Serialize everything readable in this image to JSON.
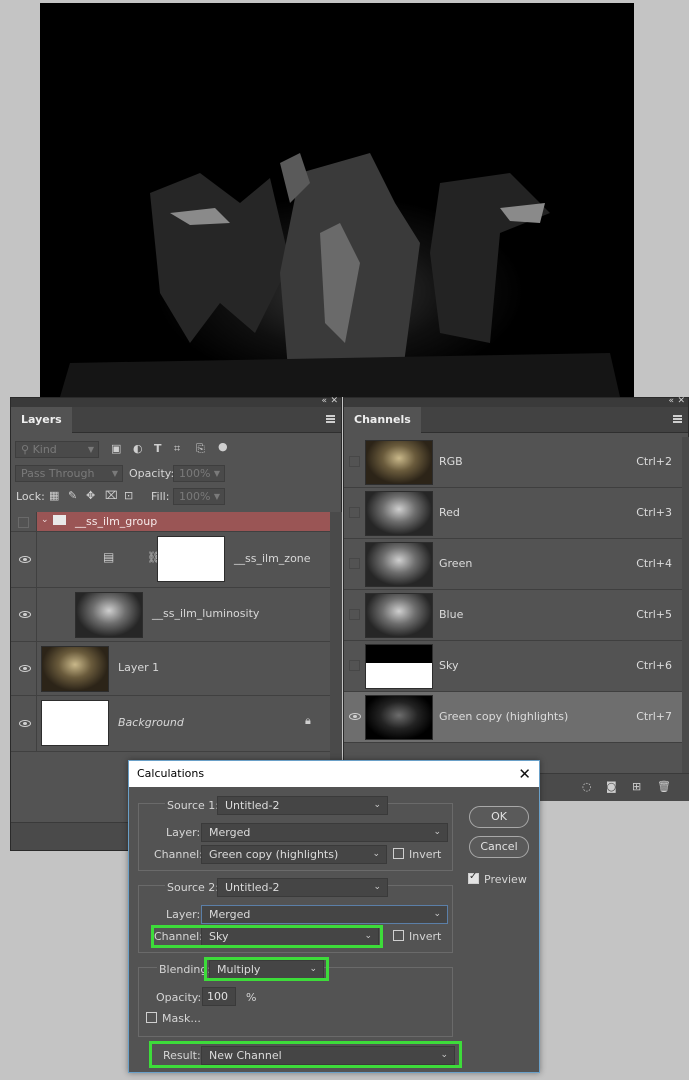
{
  "layers_panel": {
    "tab": "Layers",
    "filter_kind": "Kind",
    "blend_mode": "Pass Through",
    "opacity_label": "Opacity:",
    "opacity_value": "100%",
    "lock_label": "Lock:",
    "fill_label": "Fill:",
    "fill_value": "100%",
    "layers": [
      {
        "name": "__ss_ilm_group"
      },
      {
        "name": "__ss_ilm_zone"
      },
      {
        "name": "__ss_ilm_luminosity"
      },
      {
        "name": "Layer 1"
      },
      {
        "name": "Background"
      }
    ]
  },
  "channels_panel": {
    "tab": "Channels",
    "channels": [
      {
        "name": "RGB",
        "shortcut": "Ctrl+2"
      },
      {
        "name": "Red",
        "shortcut": "Ctrl+3"
      },
      {
        "name": "Green",
        "shortcut": "Ctrl+4"
      },
      {
        "name": "Blue",
        "shortcut": "Ctrl+5"
      },
      {
        "name": "Sky",
        "shortcut": "Ctrl+6"
      },
      {
        "name": "Green copy (highlights)",
        "shortcut": "Ctrl+7"
      }
    ]
  },
  "dialog": {
    "title": "Calculations",
    "source1": {
      "label": "Source 1:",
      "value": "Untitled-2",
      "layer_label": "Layer:",
      "layer_value": "Merged",
      "channel_label": "Channel:",
      "channel_value": "Green copy (highlights)",
      "invert_label": "Invert"
    },
    "source2": {
      "label": "Source 2:",
      "value": "Untitled-2",
      "layer_label": "Layer:",
      "layer_value": "Merged",
      "channel_label": "Channel:",
      "channel_value": "Sky",
      "invert_label": "Invert"
    },
    "blending_label": "Blending:",
    "blending_value": "Multiply",
    "opacity_label": "Opacity:",
    "opacity_value": "100",
    "opacity_unit": "%",
    "mask_label": "Mask...",
    "result_label": "Result:",
    "result_value": "New Channel",
    "ok_label": "OK",
    "cancel_label": "Cancel",
    "preview_label": "Preview",
    "highlight_color": "#3ddc3a"
  }
}
